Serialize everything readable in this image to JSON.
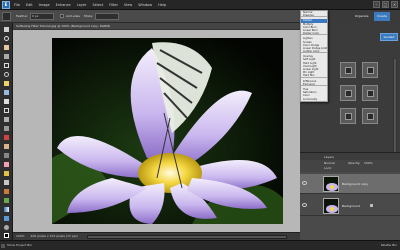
{
  "app": {
    "logo_text": "E"
  },
  "menubar": {
    "items": [
      "File",
      "Edit",
      "Image",
      "Enhance",
      "Layer",
      "Select",
      "Filter",
      "View",
      "Window",
      "Help"
    ],
    "window_controls": [
      "–",
      "□",
      "×"
    ]
  },
  "options": {
    "feather_label": "Feather:",
    "feather_value": "0 px",
    "antialias_label": "Anti-alias",
    "mode_label": "Mode:"
  },
  "document": {
    "title": "Softening Filter Tutorial.jpg @ 100% (Background copy, RGB/8)",
    "zoom": "100%",
    "doc_size": "400 pixels x 313 pixels (72 ppi)"
  },
  "panel": {
    "tab_create": "Create",
    "tab_organize": "Organize",
    "guided_label": "Guided",
    "layers_title": "Layers",
    "normal_label": "Normal",
    "opacity_label": "Opacity:",
    "opacity_value": "100%",
    "lock_label": "Lock:",
    "layers": [
      {
        "name": "Background copy",
        "selected": true
      },
      {
        "name": "Background",
        "selected": false
      }
    ]
  },
  "blend_modes": [
    "Normal",
    "Dissolve",
    "Darken",
    "Multiply",
    "Color Burn",
    "Linear Burn",
    "Darker Color",
    "Lighten",
    "Screen",
    "Color Dodge",
    "Linear Dodge (Add)",
    "Lighter Color",
    "Overlay",
    "Soft Light",
    "Hard Light",
    "Vivid Light",
    "Linear Light",
    "Pin Light",
    "Hard Mix",
    "Difference",
    "Exclusion",
    "Hue",
    "Saturation",
    "Color",
    "Luminosity"
  ],
  "blend_active": "Darken",
  "bottom": {
    "project_bin": "Show Project Bin",
    "palette_bin": "Palette Bin"
  }
}
